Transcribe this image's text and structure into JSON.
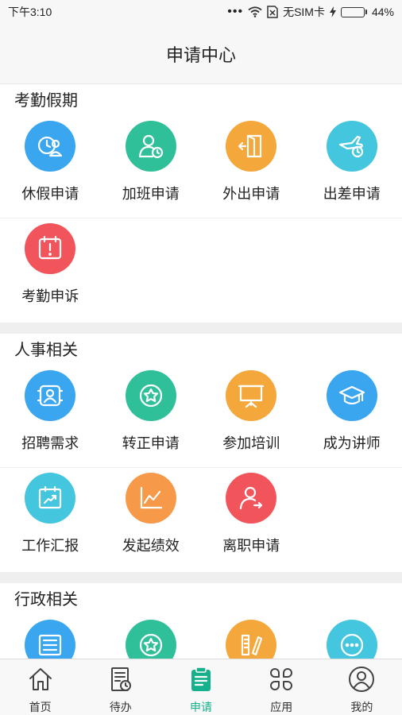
{
  "status_bar": {
    "time": "下午3:10",
    "carrier": "无SIM卡",
    "battery": "44%",
    "battery_level": 0.44
  },
  "header": {
    "title": "申请中心"
  },
  "sections": [
    {
      "title": "考勤假期",
      "rows": [
        [
          {
            "label": "休假申请",
            "icon": "vacation-icon",
            "color": "#3aa6f0"
          },
          {
            "label": "加班申请",
            "icon": "overtime-icon",
            "color": "#2fc09a"
          },
          {
            "label": "外出申请",
            "icon": "go-out-icon",
            "color": "#f4a73a"
          },
          {
            "label": "出差申请",
            "icon": "business-trip-icon",
            "color": "#43c6de"
          }
        ],
        [
          {
            "label": "考勤申诉",
            "icon": "attendance-appeal-icon",
            "color": "#f2545b"
          }
        ]
      ]
    },
    {
      "title": "人事相关",
      "rows": [
        [
          {
            "label": "招聘需求",
            "icon": "recruitment-icon",
            "color": "#3aa6f0"
          },
          {
            "label": "转正申请",
            "icon": "regularization-icon",
            "color": "#2fc09a"
          },
          {
            "label": "参加培训",
            "icon": "training-icon",
            "color": "#f4a73a"
          },
          {
            "label": "成为讲师",
            "icon": "lecturer-icon",
            "color": "#3aa6f0"
          }
        ],
        [
          {
            "label": "工作汇报",
            "icon": "work-report-icon",
            "color": "#43c6de"
          },
          {
            "label": "发起绩效",
            "icon": "performance-icon",
            "color": "#f69a4a"
          },
          {
            "label": "离职申请",
            "icon": "resignation-icon",
            "color": "#f2545b"
          }
        ]
      ]
    },
    {
      "title": "行政相关",
      "rows": [
        [
          {
            "label": "",
            "icon": "list-icon",
            "color": "#3aa6f0"
          },
          {
            "label": "",
            "icon": "star-icon",
            "color": "#2fc09a"
          },
          {
            "label": "",
            "icon": "stationery-icon",
            "color": "#f4a73a"
          },
          {
            "label": "",
            "icon": "more-icon",
            "color": "#43c6de"
          }
        ]
      ]
    }
  ],
  "tab_bar": {
    "tabs": [
      {
        "label": "首页",
        "icon": "home-icon",
        "active": false
      },
      {
        "label": "待办",
        "icon": "todo-icon",
        "active": false
      },
      {
        "label": "申请",
        "icon": "apply-icon",
        "active": true
      },
      {
        "label": "应用",
        "icon": "apps-icon",
        "active": false
      },
      {
        "label": "我的",
        "icon": "profile-icon",
        "active": false
      }
    ],
    "active_color": "#17b08d",
    "inactive_color": "#444444"
  }
}
